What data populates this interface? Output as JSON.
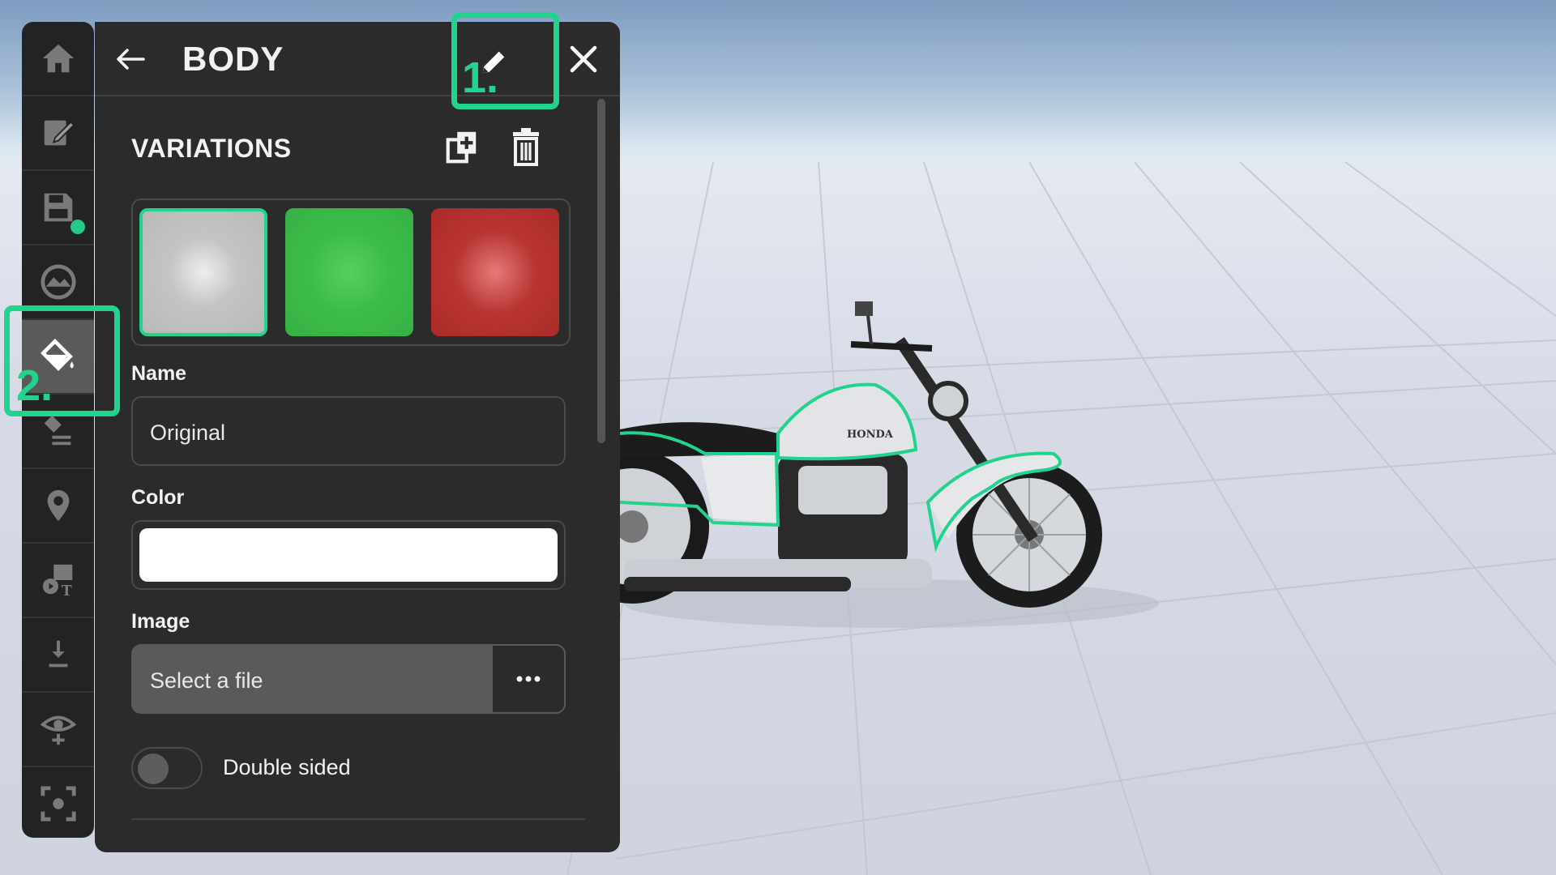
{
  "panel": {
    "title": "BODY",
    "section_title": "VARIATIONS",
    "swatches": [
      {
        "name": "original",
        "color": "#c9c9c9",
        "selected": true
      },
      {
        "name": "green",
        "color": "#3dbb4a",
        "selected": false
      },
      {
        "name": "red",
        "color": "#b3302e",
        "selected": false
      }
    ],
    "name_label": "Name",
    "name_value": "Original",
    "color_label": "Color",
    "color_value": "#ffffff",
    "image_label": "Image",
    "image_value": "Select a file",
    "double_sided_label": "Double sided",
    "double_sided_on": false
  },
  "annotations": {
    "step1": "1.",
    "step2": "2.",
    "color": "#22d38e"
  },
  "rail_icons": [
    "home-icon",
    "edit-icon",
    "save-icon",
    "environment-icon",
    "paint-bucket-icon",
    "material-layers-icon",
    "location-pin-icon",
    "media-icon",
    "download-icon",
    "visibility-icon",
    "focus-icon"
  ],
  "model_badge": "HONDA"
}
